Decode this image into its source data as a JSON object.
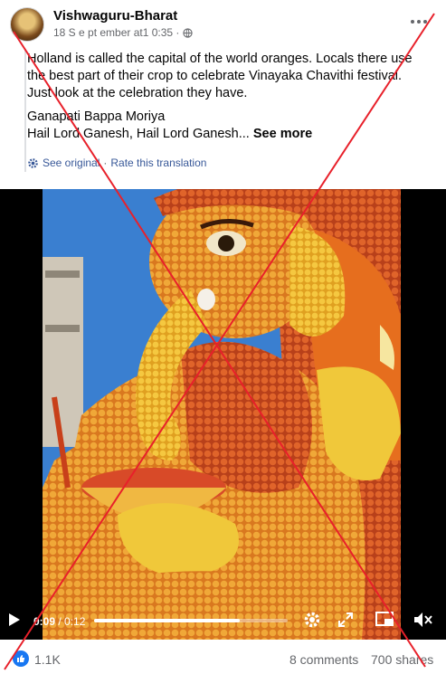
{
  "post": {
    "author": "Vishwaguru-Bharat",
    "timestamp": "18 S e pt ember at1 0:35 ·",
    "privacy_icon": "globe-icon",
    "text_lines": [
      "Holland is called the capital of the world oranges. Locals there use",
      "the best part of their crop to celebrate Vinayaka Chavithi festival.",
      "Just look at the celebration they have."
    ],
    "text_lines_2": [
      "Ganapati Bappa Moriya"
    ],
    "last_line": "Hail Lord Ganesh, Hail Lord Ganesh...",
    "see_more": "See more",
    "see_original": "See original",
    "separator": "·",
    "rate_translation": "Rate this translation"
  },
  "video": {
    "current_time": "0:09",
    "total_time": " / 0:12",
    "progress": 0.75
  },
  "stats": {
    "likes": "1.1K",
    "comments": "8 comments",
    "shares": "700 shares"
  },
  "colors": {
    "overlay_x": "#e8202a",
    "link": "#385898",
    "like_blue": "#1877f2"
  }
}
